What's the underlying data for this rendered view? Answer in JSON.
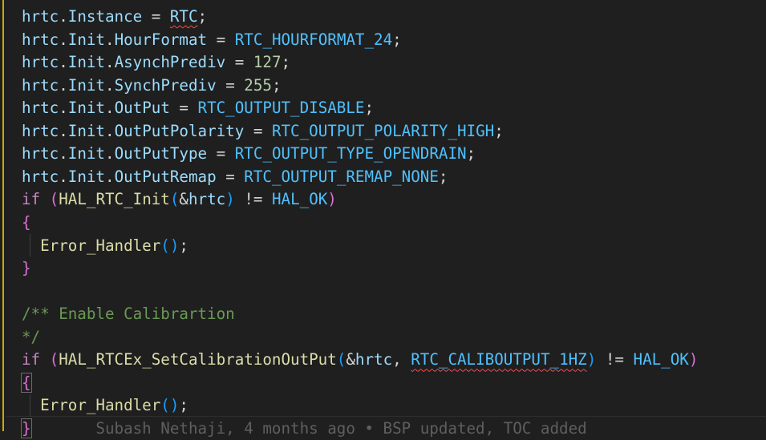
{
  "editor": {
    "colors": {
      "background": "#1f1f1f",
      "variable": "#9cdcfe",
      "macro": "#4fc1ff",
      "number": "#b5cea8",
      "function": "#dcdcaa",
      "keyword": "#c586c0",
      "bracket_outer": "#da70d6",
      "bracket_inner": "#179fff",
      "comment": "#6a9955"
    },
    "lines": [
      [
        {
          "t": "hrtc",
          "c": "var"
        },
        {
          "t": ".",
          "c": "op"
        },
        {
          "t": "Instance",
          "c": "var"
        },
        {
          "t": " = ",
          "c": "op"
        },
        {
          "t": "RTC",
          "c": "var squig"
        },
        {
          "t": ";",
          "c": "op"
        }
      ],
      [
        {
          "t": "hrtc",
          "c": "var"
        },
        {
          "t": ".",
          "c": "op"
        },
        {
          "t": "Init",
          "c": "var"
        },
        {
          "t": ".",
          "c": "op"
        },
        {
          "t": "HourFormat",
          "c": "var"
        },
        {
          "t": " = ",
          "c": "op"
        },
        {
          "t": "RTC_HOURFORMAT_24",
          "c": "mac"
        },
        {
          "t": ";",
          "c": "op"
        }
      ],
      [
        {
          "t": "hrtc",
          "c": "var"
        },
        {
          "t": ".",
          "c": "op"
        },
        {
          "t": "Init",
          "c": "var"
        },
        {
          "t": ".",
          "c": "op"
        },
        {
          "t": "AsynchPrediv",
          "c": "var"
        },
        {
          "t": " = ",
          "c": "op"
        },
        {
          "t": "127",
          "c": "num"
        },
        {
          "t": ";",
          "c": "op"
        }
      ],
      [
        {
          "t": "hrtc",
          "c": "var"
        },
        {
          "t": ".",
          "c": "op"
        },
        {
          "t": "Init",
          "c": "var"
        },
        {
          "t": ".",
          "c": "op"
        },
        {
          "t": "SynchPrediv",
          "c": "var"
        },
        {
          "t": " = ",
          "c": "op"
        },
        {
          "t": "255",
          "c": "num"
        },
        {
          "t": ";",
          "c": "op"
        }
      ],
      [
        {
          "t": "hrtc",
          "c": "var"
        },
        {
          "t": ".",
          "c": "op"
        },
        {
          "t": "Init",
          "c": "var"
        },
        {
          "t": ".",
          "c": "op"
        },
        {
          "t": "OutPut",
          "c": "var"
        },
        {
          "t": " = ",
          "c": "op"
        },
        {
          "t": "RTC_OUTPUT_DISABLE",
          "c": "mac"
        },
        {
          "t": ";",
          "c": "op"
        }
      ],
      [
        {
          "t": "hrtc",
          "c": "var"
        },
        {
          "t": ".",
          "c": "op"
        },
        {
          "t": "Init",
          "c": "var"
        },
        {
          "t": ".",
          "c": "op"
        },
        {
          "t": "OutPutPolarity",
          "c": "var"
        },
        {
          "t": " = ",
          "c": "op"
        },
        {
          "t": "RTC_OUTPUT_POLARITY_HIGH",
          "c": "mac"
        },
        {
          "t": ";",
          "c": "op"
        }
      ],
      [
        {
          "t": "hrtc",
          "c": "var"
        },
        {
          "t": ".",
          "c": "op"
        },
        {
          "t": "Init",
          "c": "var"
        },
        {
          "t": ".",
          "c": "op"
        },
        {
          "t": "OutPutType",
          "c": "var"
        },
        {
          "t": " = ",
          "c": "op"
        },
        {
          "t": "RTC_OUTPUT_TYPE_OPENDRAIN",
          "c": "mac"
        },
        {
          "t": ";",
          "c": "op"
        }
      ],
      [
        {
          "t": "hrtc",
          "c": "var"
        },
        {
          "t": ".",
          "c": "op"
        },
        {
          "t": "Init",
          "c": "var"
        },
        {
          "t": ".",
          "c": "op"
        },
        {
          "t": "OutPutRemap",
          "c": "var"
        },
        {
          "t": " = ",
          "c": "op"
        },
        {
          "t": "RTC_OUTPUT_REMAP_NONE",
          "c": "mac"
        },
        {
          "t": ";",
          "c": "op"
        }
      ],
      [
        {
          "t": "if",
          "c": "kw"
        },
        {
          "t": " ",
          "c": "op"
        },
        {
          "t": "(",
          "c": "p1"
        },
        {
          "t": "HAL_RTC_Init",
          "c": "fn"
        },
        {
          "t": "(",
          "c": "p2"
        },
        {
          "t": "&",
          "c": "op"
        },
        {
          "t": "hrtc",
          "c": "var"
        },
        {
          "t": ")",
          "c": "p2"
        },
        {
          "t": " != ",
          "c": "op"
        },
        {
          "t": "HAL_OK",
          "c": "mac"
        },
        {
          "t": ")",
          "c": "p1"
        }
      ],
      [
        {
          "t": "{",
          "c": "p1"
        }
      ],
      [
        {
          "t": "  ",
          "c": "op"
        },
        {
          "t": "Error_Handler",
          "c": "fn"
        },
        {
          "t": "()",
          "c": "p2"
        },
        {
          "t": ";",
          "c": "op"
        }
      ],
      [
        {
          "t": "}",
          "c": "p1"
        }
      ],
      [],
      [
        {
          "t": "/** Enable Calibrartion",
          "c": "cm"
        }
      ],
      [
        {
          "t": "*/",
          "c": "cm"
        }
      ],
      [
        {
          "t": "if",
          "c": "kw"
        },
        {
          "t": " ",
          "c": "op"
        },
        {
          "t": "(",
          "c": "p1"
        },
        {
          "t": "HAL_RTCEx_SetCalibrationOutPut",
          "c": "fn"
        },
        {
          "t": "(",
          "c": "p2"
        },
        {
          "t": "&",
          "c": "op"
        },
        {
          "t": "hrtc",
          "c": "var"
        },
        {
          "t": ", ",
          "c": "op"
        },
        {
          "t": "RTC_CALIBOUTPUT_1HZ",
          "c": "mac squig"
        },
        {
          "t": ")",
          "c": "p2"
        },
        {
          "t": " != ",
          "c": "op"
        },
        {
          "t": "HAL_OK",
          "c": "mac"
        },
        {
          "t": ")",
          "c": "p1"
        }
      ],
      [
        {
          "t": "{",
          "c": "p1 bracket-box"
        }
      ],
      [
        {
          "t": "  ",
          "c": "op"
        },
        {
          "t": "Error_Handler",
          "c": "fn"
        },
        {
          "t": "()",
          "c": "p2"
        },
        {
          "t": ";",
          "c": "op"
        }
      ],
      [
        {
          "t": "}",
          "c": "p1 bracket-box"
        },
        {
          "t": "       Subash Nethaji, 4 months ago • BSP updated, TOC added",
          "c": "blame"
        }
      ]
    ]
  }
}
